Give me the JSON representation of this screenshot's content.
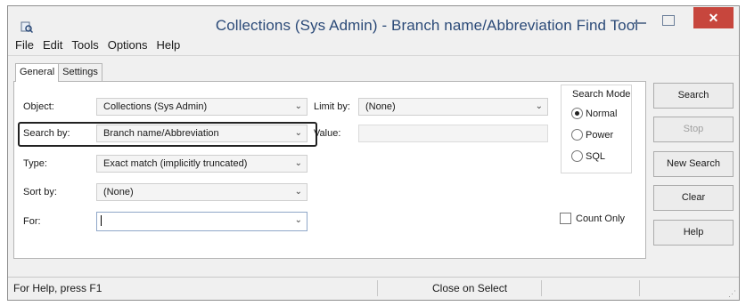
{
  "window": {
    "title": "Collections (Sys Admin) - Branch name/Abbreviation Find Tool",
    "close_glyph": "✕"
  },
  "menu": [
    "File",
    "Edit",
    "Tools",
    "Options",
    "Help"
  ],
  "tabs": [
    {
      "label": "General",
      "active": true
    },
    {
      "label": "Settings",
      "active": false
    }
  ],
  "form": {
    "object_label": "Object:",
    "object_value": "Collections (Sys Admin)",
    "limit_label": "Limit by:",
    "limit_value": "(None)",
    "searchby_label": "Search by:",
    "searchby_value": "Branch name/Abbreviation",
    "value_label": "Value:",
    "value_value": "",
    "type_label": "Type:",
    "type_value": "Exact match (implicitly truncated)",
    "sortby_label": "Sort by:",
    "sortby_value": "(None)",
    "for_label": "For:",
    "for_value": ""
  },
  "search_mode": {
    "title": "Search Mode",
    "options": [
      {
        "label": "Normal",
        "selected": true
      },
      {
        "label": "Power",
        "selected": false
      },
      {
        "label": "SQL",
        "selected": false
      }
    ]
  },
  "count_only": {
    "label": "Count Only",
    "checked": false
  },
  "buttons": [
    {
      "label": "Search",
      "enabled": true
    },
    {
      "label": "Stop",
      "enabled": false
    },
    {
      "label": "New Search",
      "enabled": true
    },
    {
      "label": "Clear",
      "enabled": true
    },
    {
      "label": "Help",
      "enabled": true
    }
  ],
  "status": {
    "help_text": "For Help, press F1",
    "close_on_select": "Close on Select"
  }
}
